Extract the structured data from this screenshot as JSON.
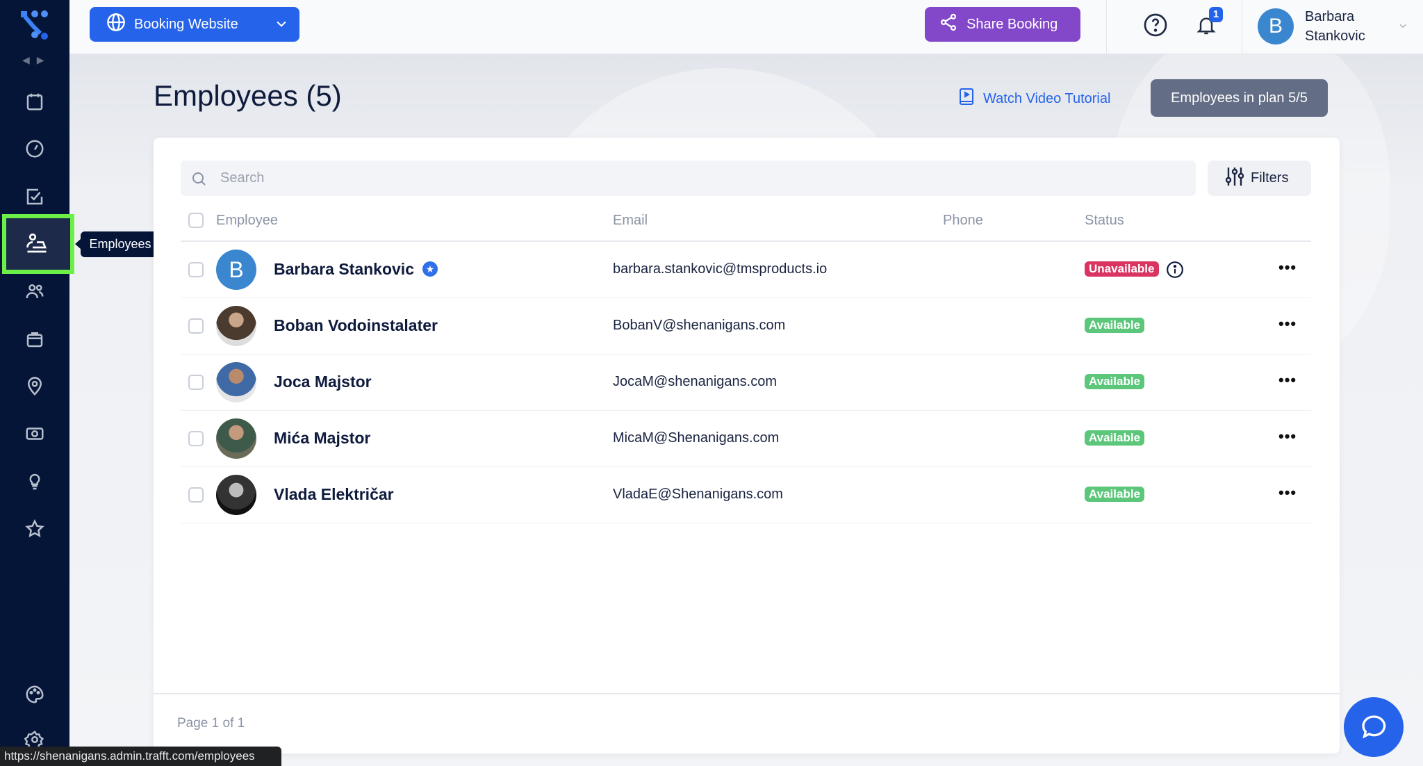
{
  "topbar": {
    "site_selector": "Booking Website",
    "share_button": "Share Booking",
    "notification_count": "1",
    "user_initial": "B",
    "user_first": "Barbara",
    "user_last": "Stankovic"
  },
  "sidebar": {
    "active": "Employees",
    "tooltip": "Employees"
  },
  "page": {
    "title": "Employees (5)",
    "video_link": "Watch Video Tutorial",
    "plan_button": "Employees in plan 5/5"
  },
  "search": {
    "placeholder": "Search"
  },
  "filters_label": "Filters",
  "table": {
    "headers": [
      "Employee",
      "Email",
      "Phone",
      "Status"
    ],
    "rows": [
      {
        "name": "Barbara Stankovic",
        "initial": "B",
        "email": "barbara.stankovic@tmsproducts.io",
        "phone": "",
        "status": "Unavailable"
      },
      {
        "name": "Boban Vodoinstalater",
        "email": "BobanV@shenanigans.com",
        "phone": "",
        "status": "Available"
      },
      {
        "name": "Joca Majstor",
        "email": "JocaM@shenanigans.com",
        "phone": "",
        "status": "Available"
      },
      {
        "name": "Mića Majstor",
        "email": "MicaM@Shenanigans.com",
        "phone": "",
        "status": "Available"
      },
      {
        "name": "Vlada Električar",
        "email": "VladaE@Shenanigans.com",
        "phone": "",
        "status": "Available"
      }
    ]
  },
  "pagination": "Page 1 of 1",
  "status_url": "https://shenanigans.admin.trafft.com/employees",
  "colors": {
    "primary": "#2563eb",
    "share": "#8347c9",
    "unavailable": "#d93462",
    "available": "#5cc67a",
    "sidebar": "#041538"
  }
}
